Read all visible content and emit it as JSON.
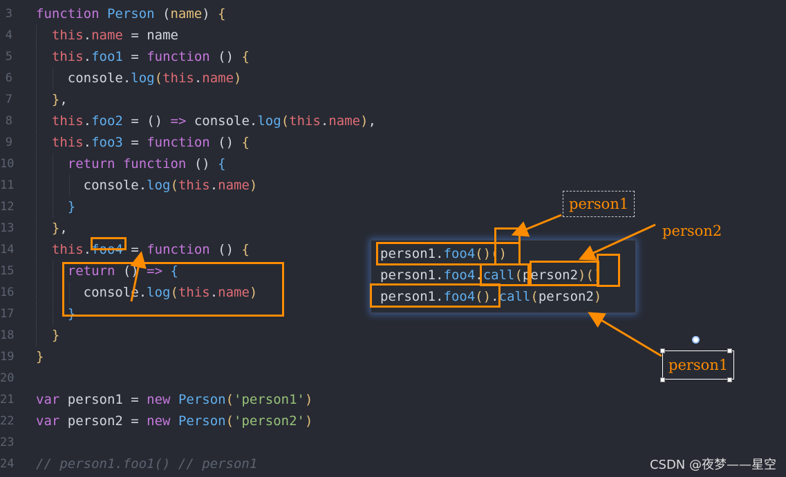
{
  "editor": {
    "lines": [
      {
        "num": "3",
        "tokens": [
          [
            "kw",
            "function "
          ],
          [
            "cl",
            "Person"
          ],
          [
            "pl",
            " ("
          ],
          [
            "pa",
            "name"
          ],
          [
            "pl",
            ") "
          ],
          [
            "pa",
            "{"
          ]
        ]
      },
      {
        "num": "4",
        "tokens": [
          [
            "pl",
            "  "
          ],
          [
            "th",
            "this"
          ],
          [
            "pl",
            "."
          ],
          [
            "pr",
            "name"
          ],
          [
            "pl",
            " = name"
          ]
        ]
      },
      {
        "num": "5",
        "tokens": [
          [
            "pl",
            "  "
          ],
          [
            "th",
            "this"
          ],
          [
            "pl",
            "."
          ],
          [
            "fn",
            "foo1"
          ],
          [
            "pl",
            " = "
          ],
          [
            "kw",
            "function"
          ],
          [
            "pl",
            " () "
          ],
          [
            "pa",
            "{"
          ]
        ]
      },
      {
        "num": "6",
        "tokens": [
          [
            "pl",
            "    console."
          ],
          [
            "fn",
            "log"
          ],
          [
            "pa",
            "("
          ],
          [
            "th",
            "this"
          ],
          [
            "pl",
            "."
          ],
          [
            "pr",
            "name"
          ],
          [
            "pa",
            ")"
          ]
        ]
      },
      {
        "num": "7",
        "tokens": [
          [
            "pl",
            "  "
          ],
          [
            "pa",
            "}"
          ],
          [
            "pl",
            ","
          ]
        ]
      },
      {
        "num": "8",
        "tokens": [
          [
            "pl",
            "  "
          ],
          [
            "th",
            "this"
          ],
          [
            "pl",
            "."
          ],
          [
            "fn",
            "foo2"
          ],
          [
            "pl",
            " = () "
          ],
          [
            "kw",
            "=>"
          ],
          [
            "pl",
            " console."
          ],
          [
            "fn",
            "log"
          ],
          [
            "pa",
            "("
          ],
          [
            "th",
            "this"
          ],
          [
            "pl",
            "."
          ],
          [
            "pr",
            "name"
          ],
          [
            "pa",
            ")"
          ],
          [
            "pl",
            ","
          ]
        ]
      },
      {
        "num": "9",
        "tokens": [
          [
            "pl",
            "  "
          ],
          [
            "th",
            "this"
          ],
          [
            "pl",
            "."
          ],
          [
            "fn",
            "foo3"
          ],
          [
            "pl",
            " = "
          ],
          [
            "kw",
            "function"
          ],
          [
            "pl",
            " () "
          ],
          [
            "pa",
            "{"
          ]
        ]
      },
      {
        "num": "10",
        "tokens": [
          [
            "pl",
            "    "
          ],
          [
            "kw",
            "return"
          ],
          [
            "pl",
            " "
          ],
          [
            "kw",
            "function"
          ],
          [
            "pl",
            " () "
          ],
          [
            "cl",
            "{"
          ]
        ]
      },
      {
        "num": "11",
        "tokens": [
          [
            "pl",
            "      console."
          ],
          [
            "fn",
            "log"
          ],
          [
            "pa",
            "("
          ],
          [
            "th",
            "this"
          ],
          [
            "pl",
            "."
          ],
          [
            "pr",
            "name"
          ],
          [
            "pa",
            ")"
          ]
        ]
      },
      {
        "num": "12",
        "tokens": [
          [
            "pl",
            "    "
          ],
          [
            "cl",
            "}"
          ]
        ]
      },
      {
        "num": "13",
        "tokens": [
          [
            "pl",
            "  "
          ],
          [
            "pa",
            "}"
          ],
          [
            "pl",
            ","
          ]
        ]
      },
      {
        "num": "14",
        "tokens": [
          [
            "pl",
            "  "
          ],
          [
            "th",
            "this"
          ],
          [
            "pl",
            "."
          ],
          [
            "fn",
            "foo4"
          ],
          [
            "pl",
            " = "
          ],
          [
            "kw",
            "function"
          ],
          [
            "pl",
            " () "
          ],
          [
            "pa",
            "{"
          ]
        ]
      },
      {
        "num": "15",
        "tokens": [
          [
            "pl",
            "    "
          ],
          [
            "kw",
            "return"
          ],
          [
            "pl",
            " () "
          ],
          [
            "kw",
            "=>"
          ],
          [
            "pl",
            " "
          ],
          [
            "cl",
            "{"
          ]
        ]
      },
      {
        "num": "16",
        "tokens": [
          [
            "pl",
            "      console."
          ],
          [
            "fn",
            "log"
          ],
          [
            "pa",
            "("
          ],
          [
            "th",
            "this"
          ],
          [
            "pl",
            "."
          ],
          [
            "pr",
            "name"
          ],
          [
            "pa",
            ")"
          ]
        ]
      },
      {
        "num": "17",
        "tokens": [
          [
            "pl",
            "    "
          ],
          [
            "cl",
            "}"
          ]
        ]
      },
      {
        "num": "18",
        "tokens": [
          [
            "pl",
            "  "
          ],
          [
            "pa",
            "}"
          ]
        ]
      },
      {
        "num": "19",
        "tokens": [
          [
            "pa",
            "}"
          ]
        ]
      },
      {
        "num": "20",
        "tokens": []
      },
      {
        "num": "21",
        "tokens": [
          [
            "kw",
            "var"
          ],
          [
            "pl",
            " person1 = "
          ],
          [
            "kw",
            "new"
          ],
          [
            "pl",
            " "
          ],
          [
            "cl",
            "Person"
          ],
          [
            "pa",
            "("
          ],
          [
            "st",
            "'person1'"
          ],
          [
            "pa",
            ")"
          ]
        ]
      },
      {
        "num": "22",
        "tokens": [
          [
            "kw",
            "var"
          ],
          [
            "pl",
            " person2 = "
          ],
          [
            "kw",
            "new"
          ],
          [
            "pl",
            " "
          ],
          [
            "cl",
            "Person"
          ],
          [
            "pa",
            "("
          ],
          [
            "st",
            "'person2'"
          ],
          [
            "pa",
            ")"
          ]
        ]
      },
      {
        "num": "23",
        "tokens": []
      },
      {
        "num": "24",
        "tokens": [
          [
            "cm",
            "// person1.foo1() // person1"
          ]
        ]
      }
    ]
  },
  "popup": {
    "lines": [
      [
        [
          "pl",
          "person1."
        ],
        [
          "fn",
          "foo4"
        ],
        [
          "pa",
          "()"
        ],
        [
          "pa",
          "()"
        ]
      ],
      [
        [
          "pl",
          "person1."
        ],
        [
          "fn",
          "foo4"
        ],
        [
          "pl",
          "."
        ],
        [
          "fn",
          "call"
        ],
        [
          "pa",
          "("
        ],
        [
          "pl",
          "person2"
        ],
        [
          "pa",
          ")"
        ],
        [
          "pa",
          "()"
        ]
      ],
      [
        [
          "pl",
          "person1."
        ],
        [
          "fn",
          "foo4"
        ],
        [
          "pa",
          "()"
        ],
        [
          "pl",
          "."
        ],
        [
          "fn",
          "call"
        ],
        [
          "pa",
          "("
        ],
        [
          "pl",
          "person2"
        ],
        [
          "pa",
          ")"
        ]
      ]
    ]
  },
  "annotations": {
    "label_top": "person1",
    "label_mid": "person2",
    "label_bottom": "person1",
    "accent_color": "#ff8c00"
  },
  "watermark": "CSDN @夜梦——星空"
}
